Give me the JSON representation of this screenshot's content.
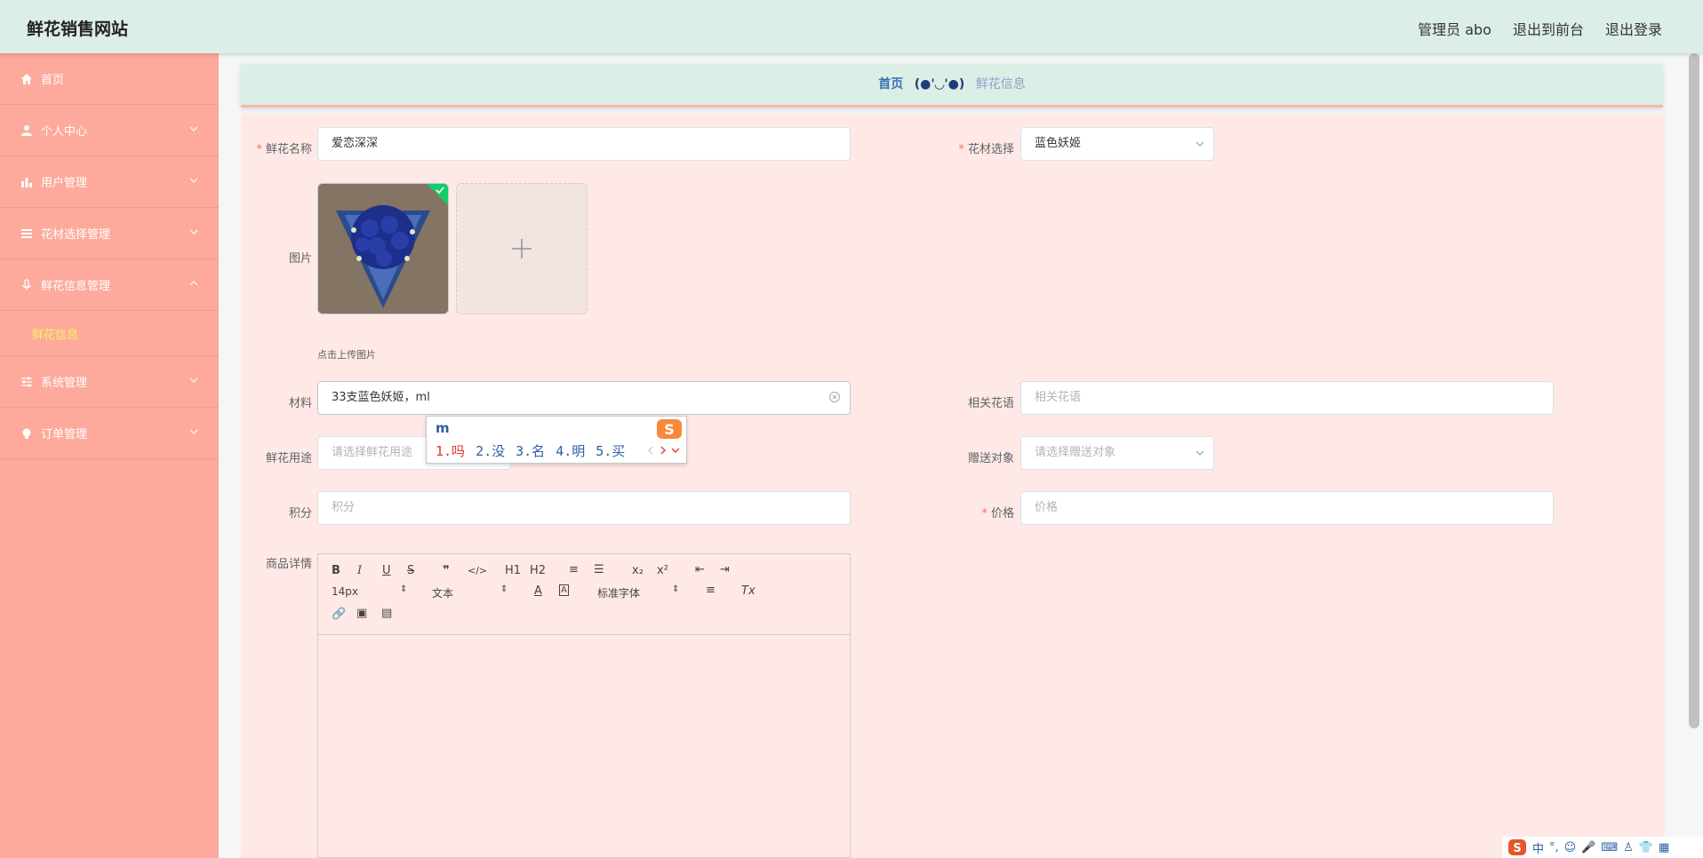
{
  "header": {
    "brand": "鲜花销售网站",
    "admin_label": "管理员 abo",
    "exit_front": "退出到前台",
    "logout": "退出登录"
  },
  "sidebar": {
    "items": [
      {
        "label": "首页",
        "icon": "home-icon"
      },
      {
        "label": "个人中心",
        "icon": "user-icon"
      },
      {
        "label": "用户管理",
        "icon": "bar-chart-icon"
      },
      {
        "label": "花材选择管理",
        "icon": "list-icon"
      },
      {
        "label": "鲜花信息管理",
        "icon": "microphone-icon"
      },
      {
        "label": "系统管理",
        "icon": "sliders-icon"
      },
      {
        "label": "订单管理",
        "icon": "bulb-icon"
      }
    ],
    "submenu_active": "鲜花信息"
  },
  "breadcrumb": {
    "home": "首页",
    "separator": "(●'◡'●)",
    "current": "鲜花信息"
  },
  "form": {
    "flower_name": {
      "label": "鲜花名称",
      "value": "爱恋深深"
    },
    "material_select": {
      "label": "花材选择",
      "value": "蓝色妖姬"
    },
    "image": {
      "label": "图片",
      "tip": "点击上传图片"
    },
    "material": {
      "label": "材料",
      "value": "33支蓝色妖姬，ml"
    },
    "flower_language": {
      "label": "相关花语",
      "placeholder": "相关花语"
    },
    "usage": {
      "label": "鲜花用途",
      "placeholder": "请选择鲜花用途"
    },
    "recipient": {
      "label": "赠送对象",
      "placeholder": "请选择赠送对象"
    },
    "points": {
      "label": "积分",
      "placeholder": "积分"
    },
    "price": {
      "label": "价格",
      "placeholder": "价格"
    },
    "details": {
      "label": "商品详情"
    }
  },
  "editor": {
    "font_size": "14px",
    "text_type": "文本",
    "font_family": "标准字体",
    "buttons_row1": [
      "B",
      "I",
      "U",
      "S",
      "❞",
      "</>",
      "H1",
      "H2",
      "≡",
      "☰",
      "x₂",
      "x²",
      "⇤",
      "⇥"
    ]
  },
  "ime": {
    "composition": "m",
    "candidates": [
      "1.吗",
      "2.没",
      "3.名",
      "4.明",
      "5.买"
    ]
  },
  "tray": {
    "lang": "中"
  },
  "colors": {
    "header_bg": "#dcefe6",
    "sidebar_bg": "#fdaa9c",
    "active_submenu": "#f7f35b",
    "form_bg": "#fee9e6"
  }
}
